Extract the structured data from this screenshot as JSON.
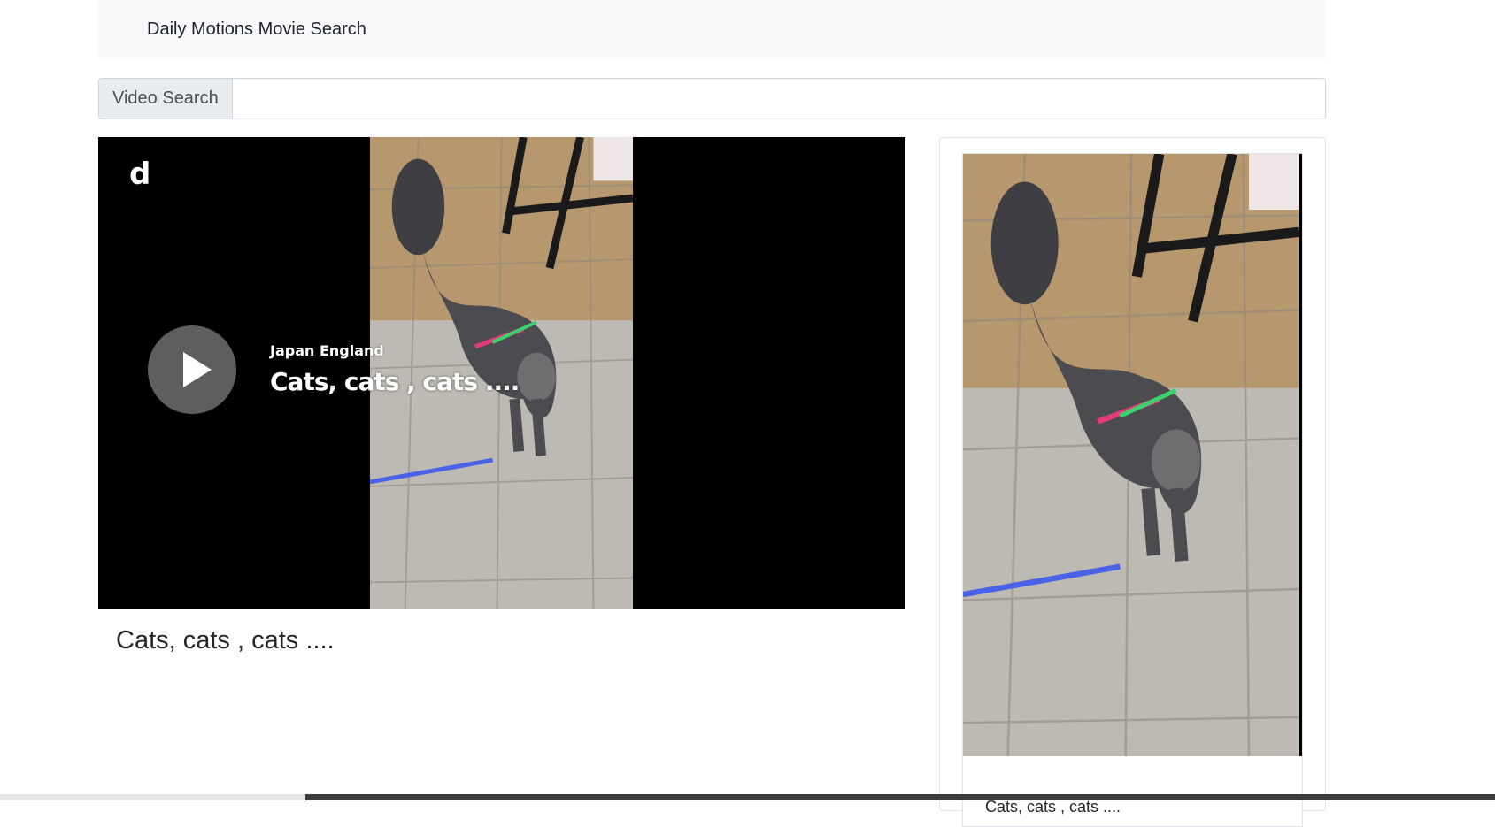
{
  "navbar": {
    "brand": "Daily Motions Movie Search"
  },
  "search": {
    "label": "Video Search",
    "value": "",
    "placeholder": ""
  },
  "player": {
    "logo": "d",
    "owner": "Japan England",
    "title": "Cats, cats , cats ....",
    "play_icon": "play-icon"
  },
  "main": {
    "video_title": "Cats, cats , cats ...."
  },
  "sidebar": {
    "videos": [
      {
        "caption": "Cats, cats , cats ...."
      }
    ]
  },
  "colors": {
    "navbar_bg": "#f8f9fa",
    "player_bg": "#000000",
    "border": "#dee2e6"
  }
}
